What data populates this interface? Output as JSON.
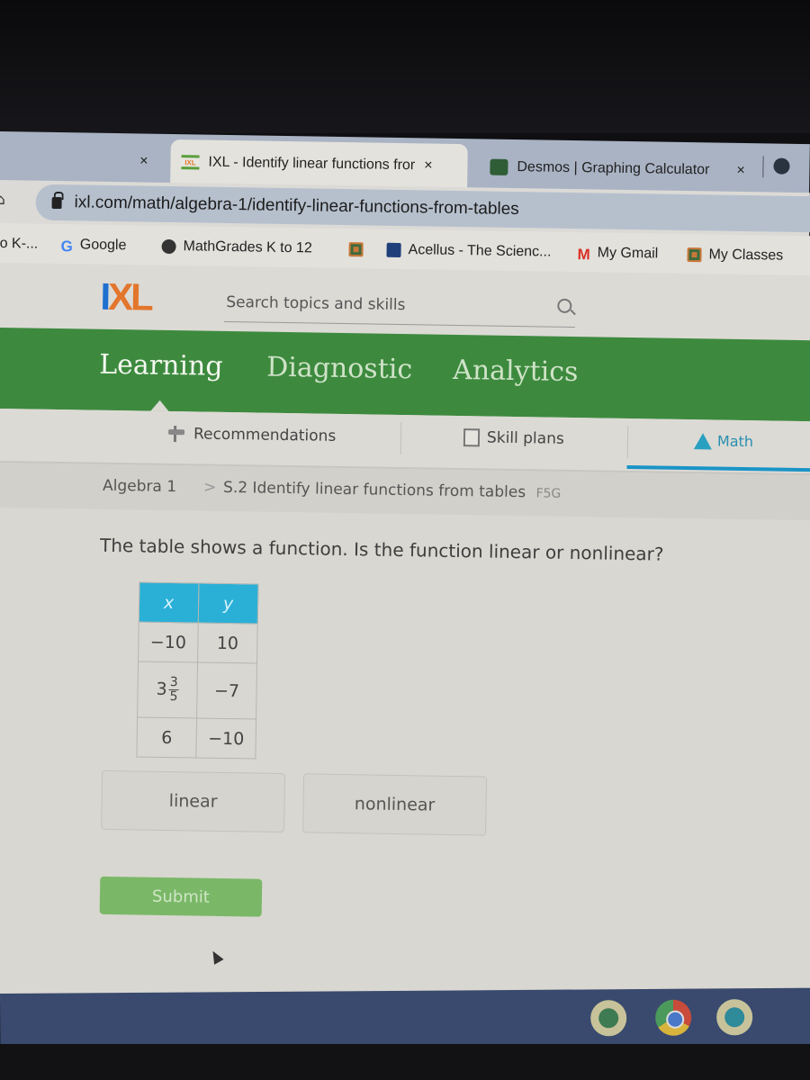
{
  "browser": {
    "tabs": [
      {
        "title": "",
        "close": "×"
      },
      {
        "title": "IXL - Identify linear functions fror",
        "favicon": "IXL",
        "close": "×",
        "active": true
      },
      {
        "title": "Desmos | Graphing Calculator",
        "close": "×"
      }
    ],
    "url": "ixl.com/math/algebra-1/identify-linear-functions-from-tables",
    "bookmarks": [
      {
        "label": "o K-...",
        "icon": "truncated-icon"
      },
      {
        "label": "Google",
        "icon": "google-icon"
      },
      {
        "label": "MathGrades K to 12",
        "icon": "globe-icon"
      },
      {
        "label": "",
        "icon": "classroom-icon"
      },
      {
        "label": "Acellus - The Scienc...",
        "icon": "acellus-icon"
      },
      {
        "label": "My Gmail",
        "icon": "gmail-icon"
      },
      {
        "label": "My Classes",
        "icon": "classroom-icon"
      }
    ]
  },
  "ixl": {
    "logo": {
      "i": "I",
      "xl": "XL"
    },
    "search_placeholder": "Search topics and skills",
    "nav": [
      {
        "label": "Learning",
        "active": true
      },
      {
        "label": "Diagnostic"
      },
      {
        "label": "Analytics"
      }
    ],
    "subnav": [
      {
        "label": "Recommendations",
        "icon": "recommendations-icon"
      },
      {
        "label": "Skill plans",
        "icon": "skill-plans-icon"
      },
      {
        "label": "Math",
        "icon": "math-icon",
        "active": true
      }
    ],
    "breadcrumb": {
      "subject": "Algebra 1",
      "separator": ">",
      "skill": "S.2 Identify linear functions from tables",
      "code": "F5G"
    },
    "question": "The table shows a function. Is the function linear or nonlinear?",
    "table": {
      "headers": [
        "x",
        "y"
      ],
      "rows": [
        {
          "x": "−10",
          "y": "10"
        },
        {
          "x_whole": "3",
          "x_num": "3",
          "x_den": "5",
          "y": "−7"
        },
        {
          "x": "6",
          "y": "−10"
        }
      ]
    },
    "choices": [
      "linear",
      "nonlinear"
    ],
    "submit_label": "Submit"
  },
  "colors": {
    "nav_green": "#3d8a3e",
    "table_header": "#2ab0d6",
    "submit": "#7ab868",
    "math_accent": "#1a94c6"
  },
  "shelf": {
    "apps": [
      "classroom-app",
      "chrome-app",
      "files-app"
    ]
  }
}
